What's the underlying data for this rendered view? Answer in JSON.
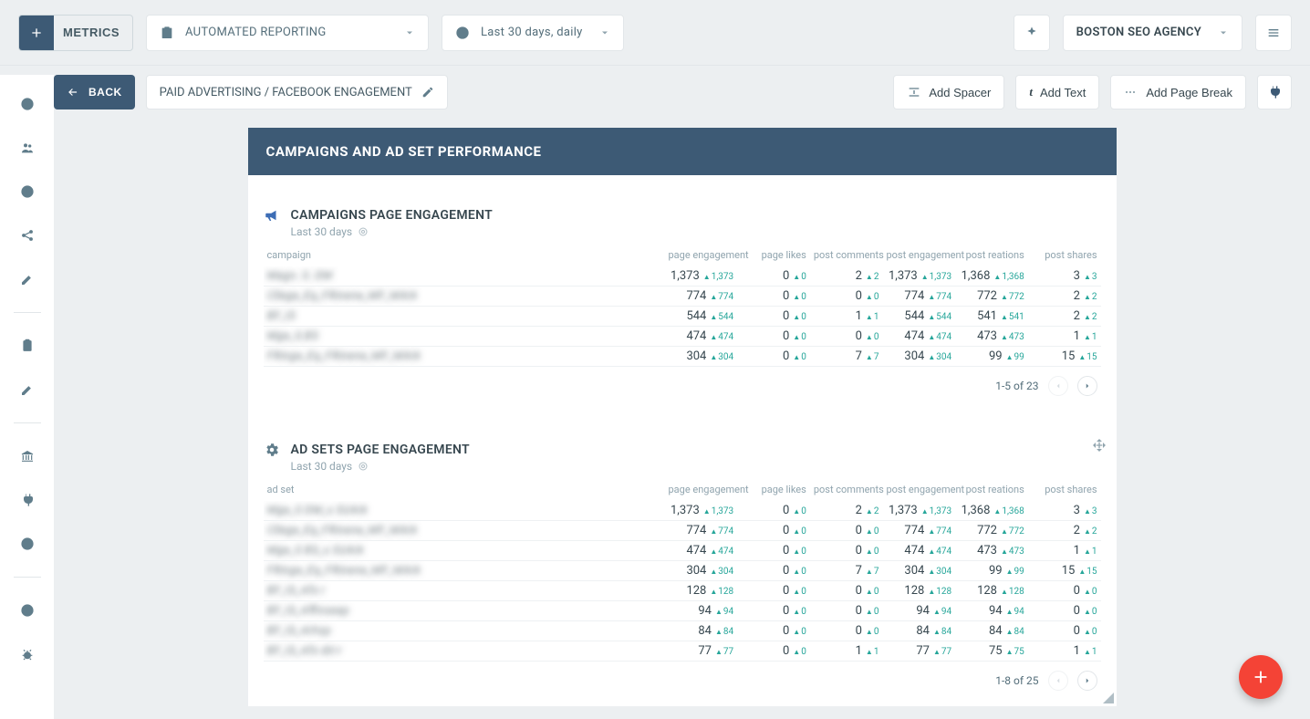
{
  "header": {
    "metrics_label": "METRICS",
    "report_select": "AUTOMATED REPORTING",
    "date_select": "Last 30 days, daily",
    "agency": "BOSTON SEO AGENCY"
  },
  "subtoolbar": {
    "back_label": "BACK",
    "breadcrumb": "PAID ADVERTISING / FACEBOOK ENGAGEMENT",
    "add_spacer": "Add Spacer",
    "add_text": "Add Text",
    "add_page_break": "Add Page Break"
  },
  "banner": "CAMPAIGNS AND AD SET PERFORMANCE",
  "widgets": {
    "campaigns": {
      "title": "CAMPAIGNS PAGE ENGAGEMENT",
      "subtitle": "Last 30 days",
      "name_header": "campaign",
      "columns": [
        "page engagement",
        "page likes",
        "post comments",
        "post engagement",
        "post reations",
        "post shares"
      ],
      "rows": [
        {
          "name": "Magn. S. DM",
          "cells": [
            {
              "v": "1,373",
              "d": "1,373"
            },
            {
              "v": "0",
              "d": "0"
            },
            {
              "v": "2",
              "d": "2"
            },
            {
              "v": "1,373",
              "d": "1,373"
            },
            {
              "v": "1,368",
              "d": "1,368"
            },
            {
              "v": "3",
              "d": "3"
            }
          ]
        },
        {
          "name": "Cllege_Eq_FRinene_MF_MArk",
          "cells": [
            {
              "v": "774",
              "d": "774"
            },
            {
              "v": "0",
              "d": "0"
            },
            {
              "v": "0",
              "d": "0"
            },
            {
              "v": "774",
              "d": "774"
            },
            {
              "v": "772",
              "d": "772"
            },
            {
              "v": "2",
              "d": "2"
            }
          ]
        },
        {
          "name": "BF_IS",
          "cells": [
            {
              "v": "544",
              "d": "544"
            },
            {
              "v": "0",
              "d": "0"
            },
            {
              "v": "1",
              "d": "1"
            },
            {
              "v": "544",
              "d": "544"
            },
            {
              "v": "541",
              "d": "541"
            },
            {
              "v": "2",
              "d": "2"
            }
          ]
        },
        {
          "name": "Mge_S.BS",
          "cells": [
            {
              "v": "474",
              "d": "474"
            },
            {
              "v": "0",
              "d": "0"
            },
            {
              "v": "0",
              "d": "0"
            },
            {
              "v": "474",
              "d": "474"
            },
            {
              "v": "473",
              "d": "473"
            },
            {
              "v": "1",
              "d": "1"
            }
          ]
        },
        {
          "name": "FRinge_Eq_FRinene_MF_MArk",
          "cells": [
            {
              "v": "304",
              "d": "304"
            },
            {
              "v": "0",
              "d": "0"
            },
            {
              "v": "7",
              "d": "7"
            },
            {
              "v": "304",
              "d": "304"
            },
            {
              "v": "99",
              "d": "99"
            },
            {
              "v": "15",
              "d": "15"
            }
          ]
        }
      ],
      "pager": "1-5 of 23"
    },
    "adsets": {
      "title": "AD SETS PAGE ENGAGEMENT",
      "subtitle": "Last 30 days",
      "name_header": "ad set",
      "columns": [
        "page engagement",
        "page likes",
        "post comments",
        "post engagement",
        "post reations",
        "post shares"
      ],
      "rows": [
        {
          "name": "Mge_S DM_s SUArk",
          "cells": [
            {
              "v": "1,373",
              "d": "1,373"
            },
            {
              "v": "0",
              "d": "0"
            },
            {
              "v": "2",
              "d": "2"
            },
            {
              "v": "1,373",
              "d": "1,373"
            },
            {
              "v": "1,368",
              "d": "1,368"
            },
            {
              "v": "3",
              "d": "3"
            }
          ]
        },
        {
          "name": "Cllege_Eq_FRinene_MF_MArk",
          "cells": [
            {
              "v": "774",
              "d": "774"
            },
            {
              "v": "0",
              "d": "0"
            },
            {
              "v": "0",
              "d": "0"
            },
            {
              "v": "774",
              "d": "774"
            },
            {
              "v": "772",
              "d": "772"
            },
            {
              "v": "2",
              "d": "2"
            }
          ]
        },
        {
          "name": "Mge_S BS_s SUArk",
          "cells": [
            {
              "v": "474",
              "d": "474"
            },
            {
              "v": "0",
              "d": "0"
            },
            {
              "v": "0",
              "d": "0"
            },
            {
              "v": "474",
              "d": "474"
            },
            {
              "v": "473",
              "d": "473"
            },
            {
              "v": "1",
              "d": "1"
            }
          ]
        },
        {
          "name": "FRinge_Eq_FRinene_MF_MArk",
          "cells": [
            {
              "v": "304",
              "d": "304"
            },
            {
              "v": "0",
              "d": "0"
            },
            {
              "v": "7",
              "d": "7"
            },
            {
              "v": "304",
              "d": "304"
            },
            {
              "v": "99",
              "d": "99"
            },
            {
              "v": "15",
              "d": "15"
            }
          ]
        },
        {
          "name": "BF_IS_Afs r",
          "cells": [
            {
              "v": "128",
              "d": "128"
            },
            {
              "v": "0",
              "d": "0"
            },
            {
              "v": "0",
              "d": "0"
            },
            {
              "v": "128",
              "d": "128"
            },
            {
              "v": "128",
              "d": "128"
            },
            {
              "v": "0",
              "d": "0"
            }
          ]
        },
        {
          "name": "BF_IS_Affinseap",
          "cells": [
            {
              "v": "94",
              "d": "94"
            },
            {
              "v": "0",
              "d": "0"
            },
            {
              "v": "0",
              "d": "0"
            },
            {
              "v": "94",
              "d": "94"
            },
            {
              "v": "94",
              "d": "94"
            },
            {
              "v": "0",
              "d": "0"
            }
          ]
        },
        {
          "name": "BF_IS_Arhsp",
          "cells": [
            {
              "v": "84",
              "d": "84"
            },
            {
              "v": "0",
              "d": "0"
            },
            {
              "v": "0",
              "d": "0"
            },
            {
              "v": "84",
              "d": "84"
            },
            {
              "v": "84",
              "d": "84"
            },
            {
              "v": "0",
              "d": "0"
            }
          ]
        },
        {
          "name": "BF_IS_Afs dir-r",
          "cells": [
            {
              "v": "77",
              "d": "77"
            },
            {
              "v": "0",
              "d": "0"
            },
            {
              "v": "1",
              "d": "1"
            },
            {
              "v": "77",
              "d": "77"
            },
            {
              "v": "75",
              "d": "75"
            },
            {
              "v": "1",
              "d": "1"
            }
          ]
        }
      ],
      "pager": "1-8 of 25"
    }
  }
}
